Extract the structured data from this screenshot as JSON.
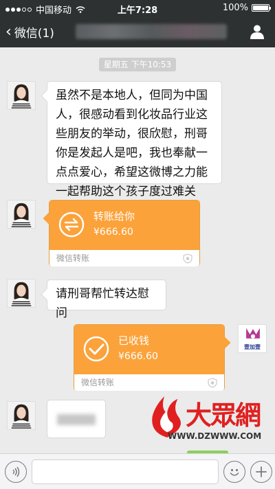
{
  "status_bar": {
    "carrier": "中国移动",
    "time": "上午7:28",
    "battery": "100%",
    "battery_level": 1.0
  },
  "nav": {
    "back_label": "微信(1)",
    "person_icon": "person-icon"
  },
  "chat": {
    "timestamp": "星期五 下午10:53",
    "messages": [
      {
        "type": "text",
        "side": "left",
        "text": "虽然不是本地人，但同为中国人，很感动看到化妆品行业这些朋友的举动，很欣慰，刑哥你是发起人是吧，我也奉献一点点爱心，希望这微博之力能一起帮助这个孩子度过难关"
      },
      {
        "type": "transfer",
        "side": "left",
        "title": "转账给你",
        "amount": "¥666.60",
        "footer": "微信转账"
      },
      {
        "type": "text",
        "side": "left",
        "text": "请刑哥帮忙转达慰问"
      },
      {
        "type": "transfer",
        "side": "right",
        "title": "已收钱",
        "amount": "¥666.60",
        "footer": "微信转账"
      }
    ],
    "sender_logo_label": "壹加壹"
  },
  "watermark": {
    "text": "大眾網",
    "url": "WWW.DZWWW.COM"
  },
  "colors": {
    "header": "#2e3132",
    "chat_bg": "#ebebeb",
    "transfer_orange": "#fba23b"
  }
}
